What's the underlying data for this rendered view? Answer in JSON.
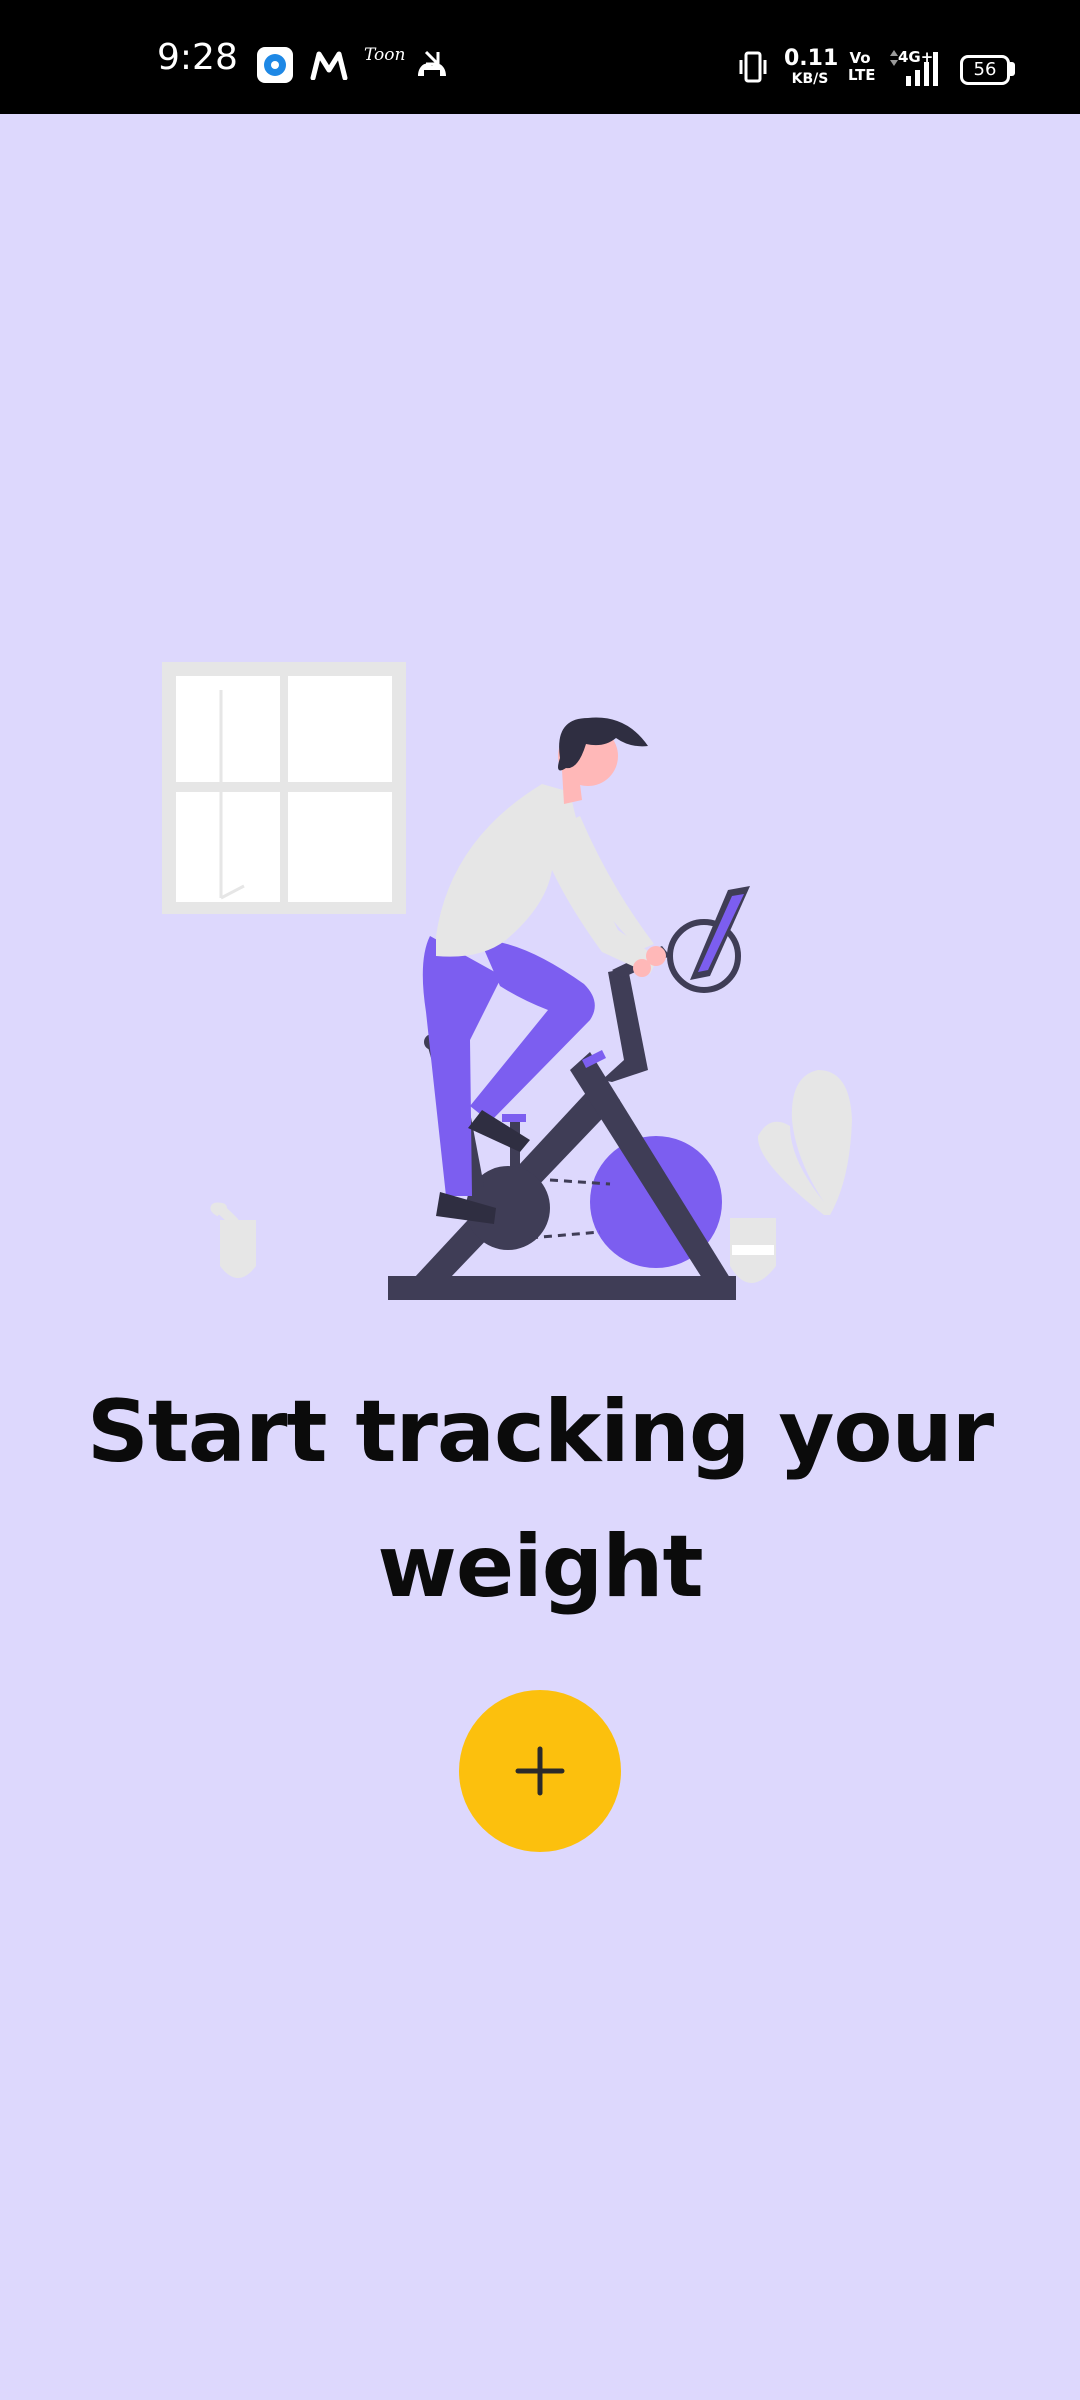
{
  "status_bar": {
    "time": "9:28",
    "notification_icons": [
      "pin-app-icon",
      "myntra-icon",
      "toonme-icon",
      "missed-call-icon"
    ],
    "toonme_text": "Toon Me",
    "vibrate_icon": "vibrate-icon",
    "network_speed_value": "0.11",
    "network_speed_unit": "KB/S",
    "volte_line1": "Vo",
    "volte_line2": "LTE",
    "network_type": "4G+",
    "signal_icon": "signal-icon",
    "battery_level": "56"
  },
  "illustration": {
    "name": "person-on-exercise-bike-illustration",
    "colors": {
      "background": "#ddd8fd",
      "accent_purple": "#7c5ef0",
      "dark": "#3f3d56",
      "light_gray": "#e6e6e6",
      "skin": "#ffb8b8",
      "white": "#ffffff"
    }
  },
  "main": {
    "headline_line1": "Start tracking your",
    "headline_line2": "weight",
    "add_button_icon": "plus-icon",
    "add_button_color": "#fcc00d"
  }
}
